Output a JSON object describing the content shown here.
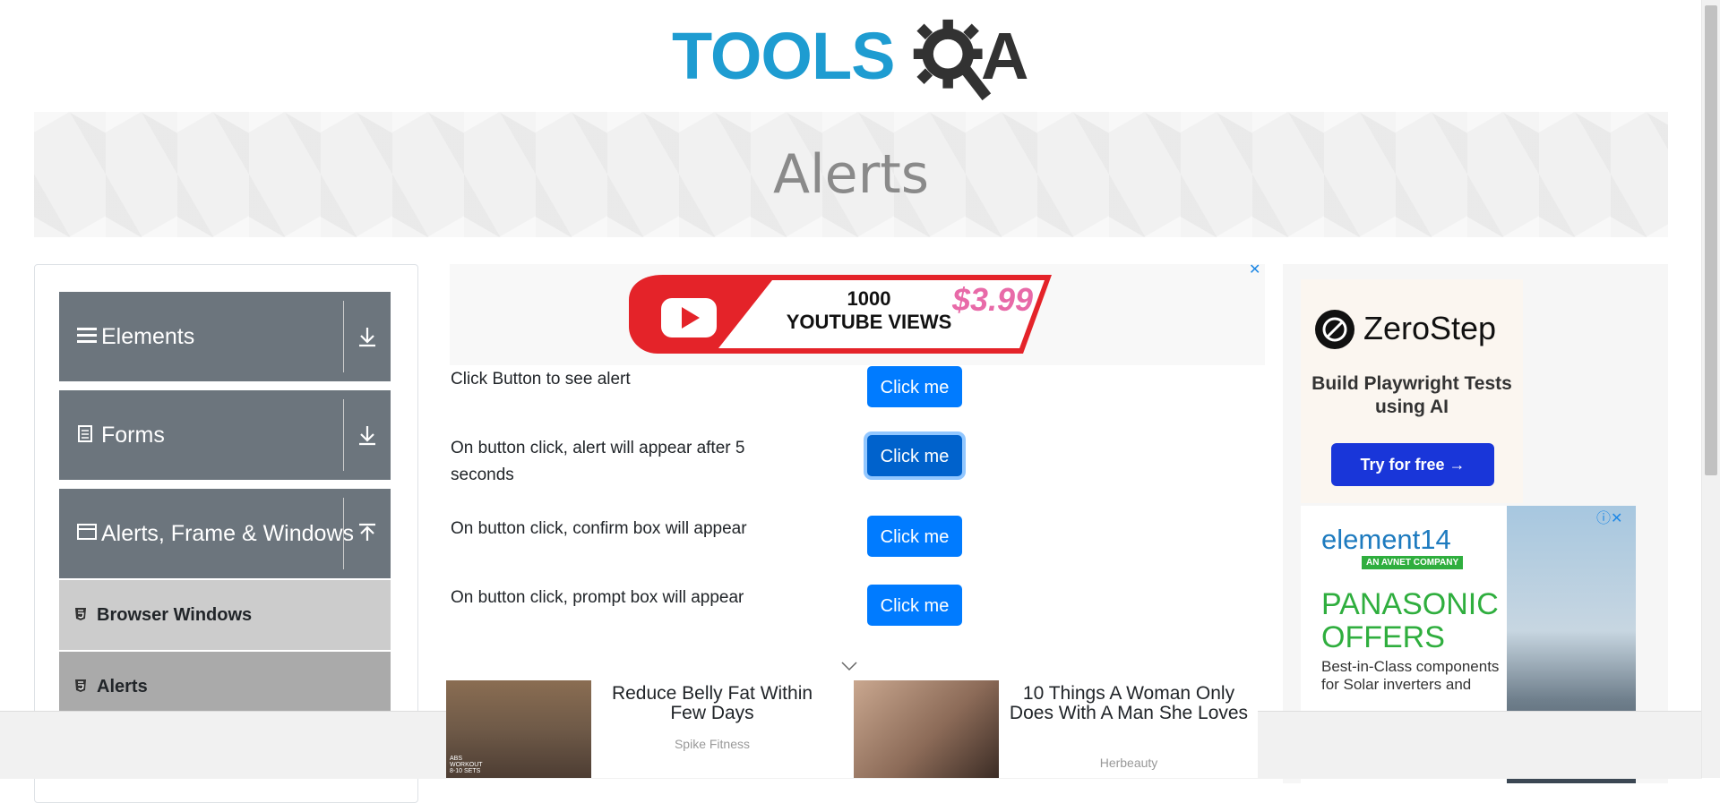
{
  "logo": {
    "text_tools": "TOOLS",
    "text_a": "A"
  },
  "banner": {
    "title": "Alerts"
  },
  "sidebar": {
    "groups": [
      {
        "label": "Elements",
        "icon": "hamburger-icon",
        "state": "collapsed"
      },
      {
        "label": "Forms",
        "icon": "document-icon",
        "state": "collapsed"
      },
      {
        "label": "Alerts, Frame & Windows",
        "icon": "window-icon",
        "state": "expanded"
      }
    ],
    "subitems": [
      {
        "label": "Browser Windows",
        "active": false
      },
      {
        "label": "Alerts",
        "active": true
      }
    ]
  },
  "top_ad": {
    "line1": "1000",
    "line2": "YOUTUBE VIEWS",
    "price": "$3.99"
  },
  "alerts": [
    {
      "label": "Click Button to see alert",
      "button": "Click me"
    },
    {
      "label": "On button click, alert will appear after 5 seconds",
      "button": "Click me",
      "focused": true
    },
    {
      "label": "On button click, confirm box will appear",
      "button": "Click me"
    },
    {
      "label": "On button click, prompt box will appear",
      "button": "Click me"
    }
  ],
  "right_ad": {
    "zerostep": {
      "name": "ZeroStep",
      "tagline": "Build Playwright Tests using AI",
      "cta": "Try for free →"
    },
    "element14": {
      "name": "element14",
      "tag": "AN AVNET COMPANY",
      "offer": "PANASONIC OFFERS",
      "desc": "Best-in-Class components for Solar inverters and"
    }
  },
  "bottom_ads": [
    {
      "title": "Reduce Belly Fat Within Few Days",
      "source": "Spike Fitness",
      "img_caption": "ABS WORKOUT 8-10 SETS"
    },
    {
      "title": "10 Things A Woman Only Does With A Man She Loves",
      "source": "Herbeauty"
    }
  ],
  "colors": {
    "primary": "#007bff",
    "sidebar_group": "#6c757d",
    "logo_blue": "#1e9cd1"
  }
}
